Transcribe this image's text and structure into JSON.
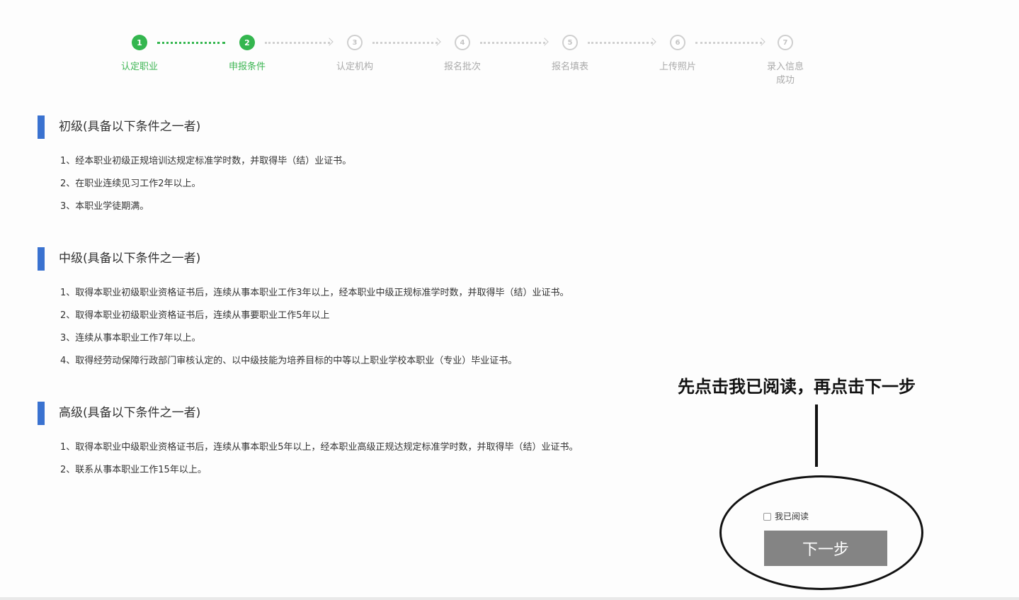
{
  "steps": [
    {
      "num": "1",
      "label": "认定职业",
      "label2": "",
      "state": "done"
    },
    {
      "num": "2",
      "label": "申报条件",
      "label2": "",
      "state": "done"
    },
    {
      "num": "3",
      "label": "认定机构",
      "label2": "",
      "state": "todo"
    },
    {
      "num": "4",
      "label": "报名批次",
      "label2": "",
      "state": "todo"
    },
    {
      "num": "5",
      "label": "报名填表",
      "label2": "",
      "state": "todo"
    },
    {
      "num": "6",
      "label": "上传照片",
      "label2": "",
      "state": "todo"
    },
    {
      "num": "7",
      "label": "录入信息",
      "label2": "成功",
      "state": "todo"
    }
  ],
  "sections": [
    {
      "title": "初级(具备以下条件之一者)",
      "items": [
        "1、经本职业初级正规培训达规定标准学时数，并取得毕（结）业证书。",
        "2、在职业连续见习工作2年以上。",
        "3、本职业学徒期满。"
      ]
    },
    {
      "title": "中级(具备以下条件之一者)",
      "items": [
        "1、取得本职业初级职业资格证书后，连续从事本职业工作3年以上，经本职业中级正规标准学时数，并取得毕（结）业证书。",
        "2、取得本职业初级职业资格证书后，连续从事要职业工作5年以上",
        "3、连续从事本职业工作7年以上。",
        "4、取得经劳动保障行政部门审核认定的、以中级技能为培养目标的中等以上职业学校本职业（专业）毕业证书。"
      ]
    },
    {
      "title": "高级(具备以下条件之一者)",
      "items": [
        "1、取得本职业中级职业资格证书后，连续从事本职业5年以上，经本职业高级正规达规定标准学时数，并取得毕（结）业证书。",
        "2、联系从事本职业工作15年以上。"
      ]
    }
  ],
  "annotation": {
    "text": "先点击我已阅读，再点击下一步"
  },
  "agreement": {
    "label": "我已阅读",
    "checked": false
  },
  "next_button": {
    "label": "下一步"
  },
  "colors": {
    "step_done": "#34b64f",
    "step_todo": "#cfcfcf",
    "section_bar": "#3a72d0",
    "button_disabled": "#848484"
  }
}
